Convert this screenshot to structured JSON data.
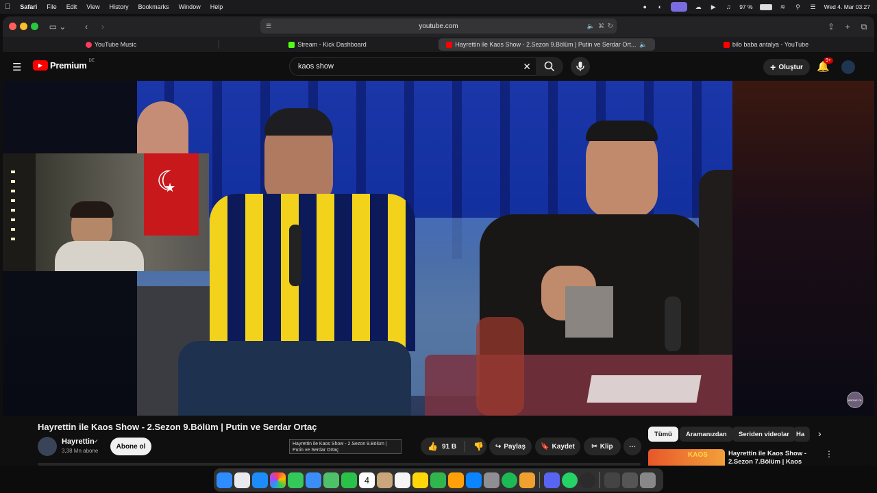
{
  "menubar": {
    "apple": "",
    "items": [
      "Safari",
      "File",
      "Edit",
      "View",
      "History",
      "Bookmarks",
      "Window",
      "Help"
    ],
    "battery": "97 %",
    "datetime": "Wed 4. Mar  03:27"
  },
  "browser": {
    "url": "youtube.com",
    "tabs": [
      {
        "label": "YouTube Music",
        "color": "#ff3b5c"
      },
      {
        "label": "Stream - Kick Dashboard",
        "color": "#53fc18"
      },
      {
        "label": "Hayrettin ile Kaos Show - 2.Sezon 9.Bölüm | Putin ve Serdar Ort...",
        "color": "#ff0000"
      },
      {
        "label": "bilo baba antalya - YouTube",
        "color": "#ff0000"
      }
    ]
  },
  "youtube": {
    "logo": "Premium",
    "logo_region": "DE",
    "search_value": "kaos show",
    "create_label": "Oluştur",
    "notification_badge": "9+"
  },
  "video": {
    "title": "Hayrettin ile Kaos Show - 2.Sezon 9.Bölüm | Putin ve Serdar Ortaç",
    "channel_name": "Hayrettin",
    "subscribers": "3,38 Mn abone",
    "subscribe_label": "Abone ol",
    "likes": "91 B",
    "share_label": "Paylaş",
    "save_label": "Kaydet",
    "clip_label": "Klip",
    "tooltip": "Hayrettin ile Kaos Show - 2.Sezon 9.Bölüm | Putin ve Serdar Ortaç",
    "watermark": "ABONE OL"
  },
  "chips": [
    "Tümü",
    "Aramanızdan",
    "Seriden videolar",
    "Ha"
  ],
  "recommendation": {
    "thumb_text": "KAOS",
    "title": "Hayrettin ile Kaos Show - 2.Sezon 7.Bölüm | Kaos Ortay..."
  },
  "dock": {
    "calendar_day": "4"
  },
  "colors": {
    "yt_red": "#ff0000",
    "bg": "#0f0f0f",
    "chip_bg": "#272727"
  }
}
